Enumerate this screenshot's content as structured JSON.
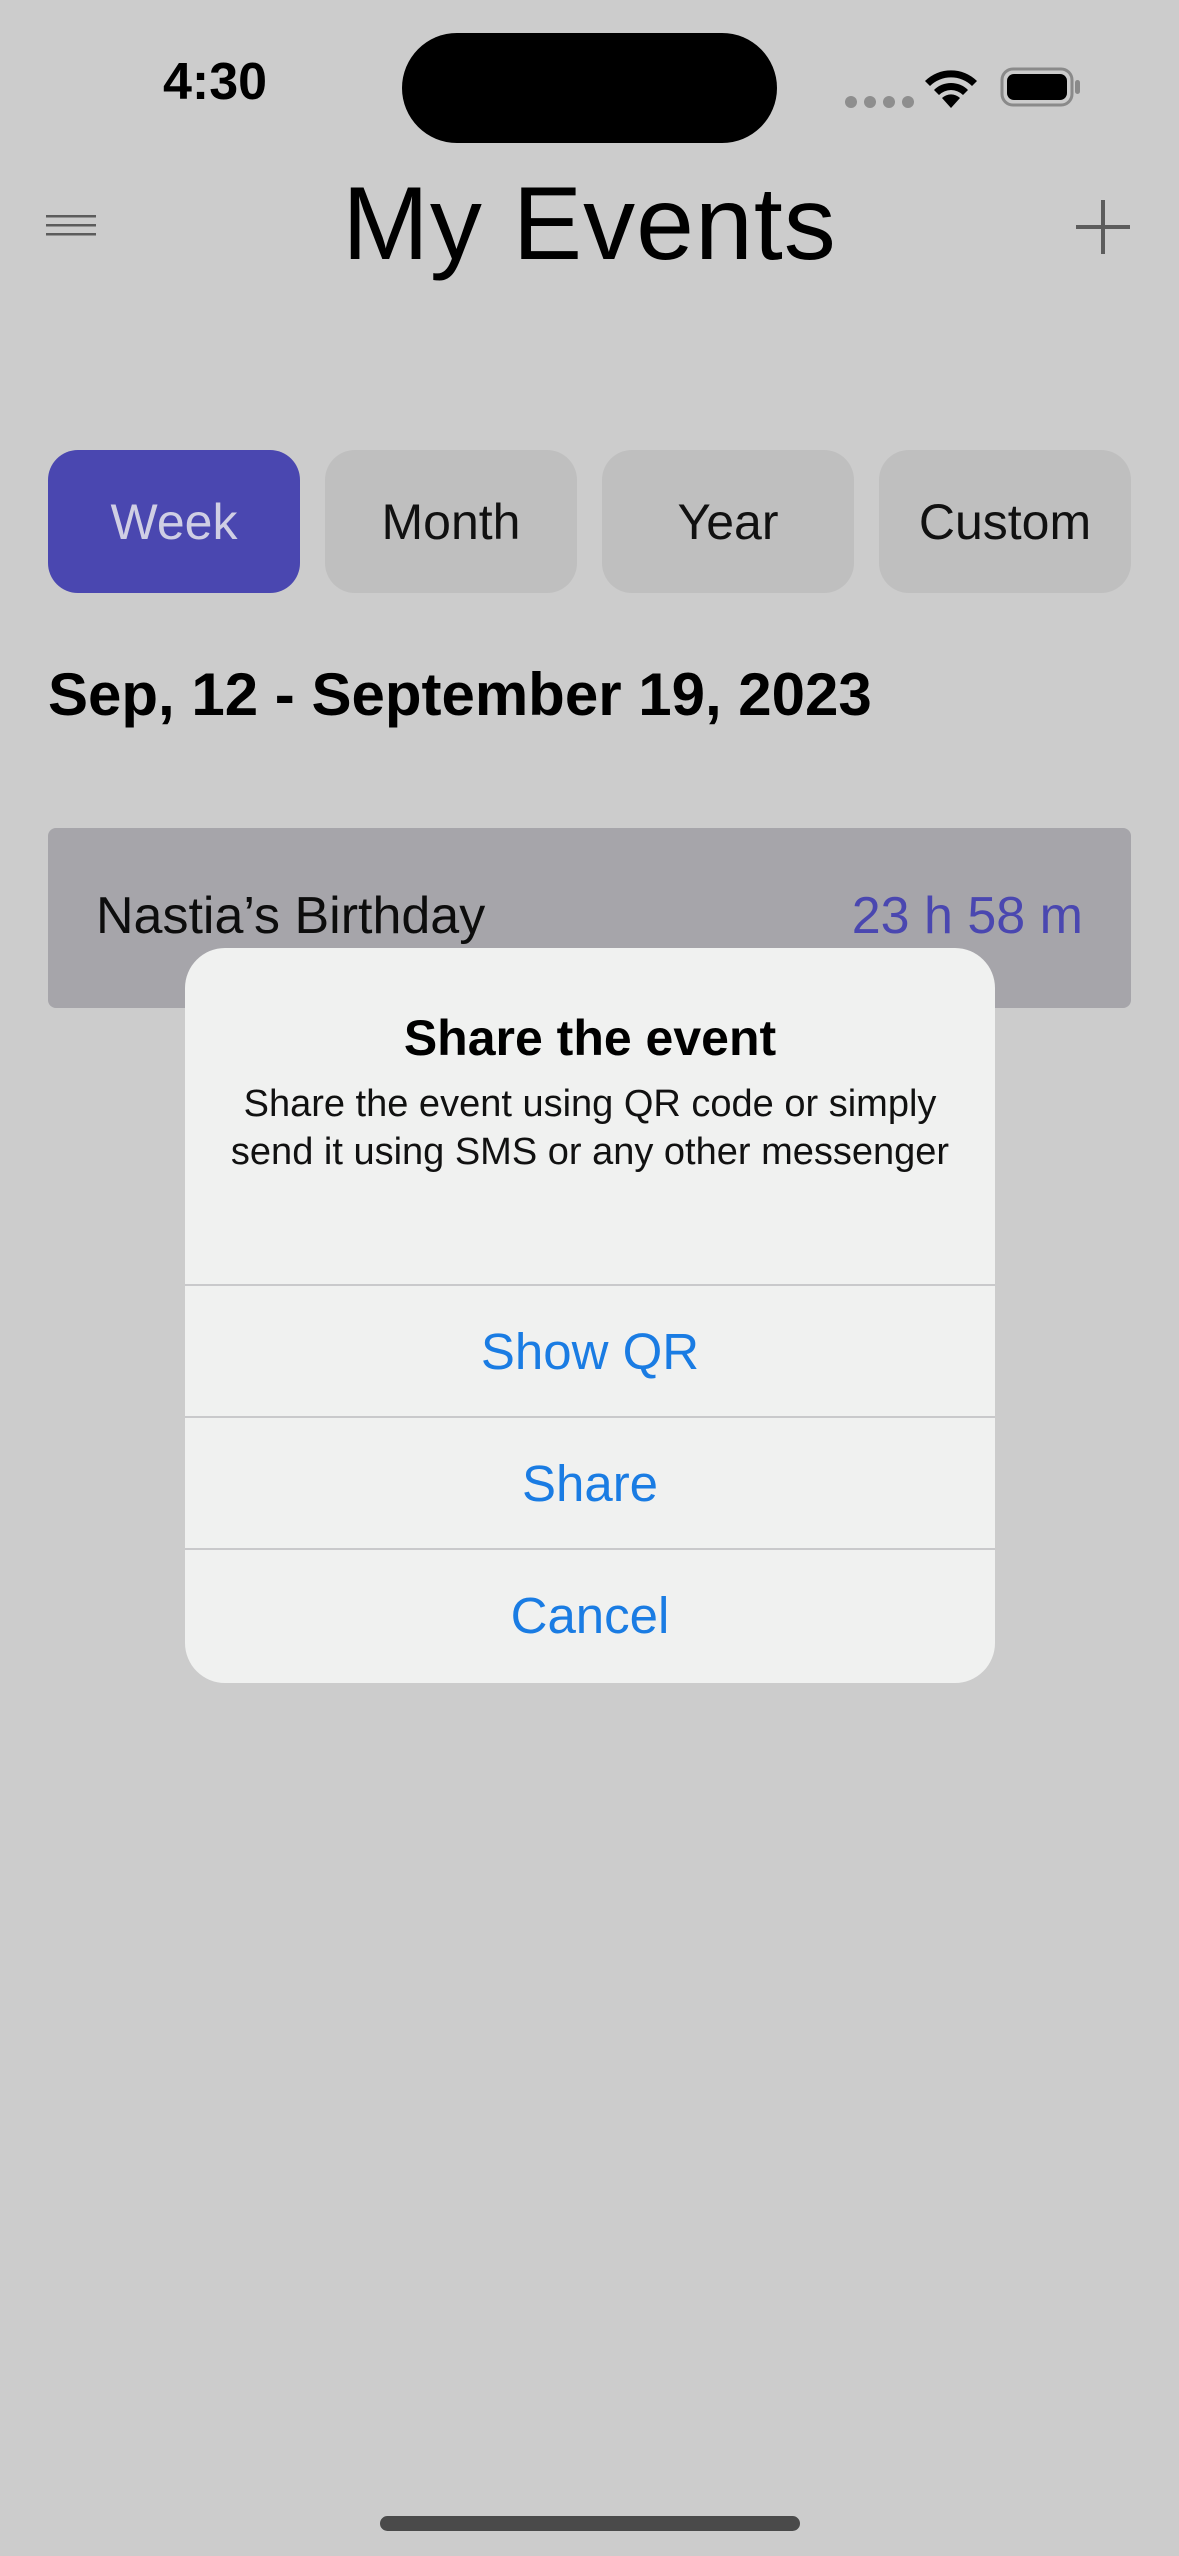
{
  "status_bar": {
    "time": "4:30"
  },
  "header": {
    "title": "My Events",
    "menu_icon": "hamburger-menu-icon",
    "add_icon": "plus-icon"
  },
  "tabs": [
    {
      "label": "Week",
      "active": true
    },
    {
      "label": "Month",
      "active": false
    },
    {
      "label": "Year",
      "active": false
    },
    {
      "label": "Custom",
      "active": false
    }
  ],
  "date_range": "Sep, 12 - September 19, 2023",
  "events": [
    {
      "name": "Nastia’s Birthday",
      "remaining": "23 h 58 m"
    }
  ],
  "alert": {
    "title": "Share the event",
    "message": "Share the event using QR code or simply send it using SMS or any other messenger",
    "actions": [
      {
        "label": "Show QR"
      },
      {
        "label": "Share"
      },
      {
        "label": "Cancel"
      }
    ]
  },
  "colors": {
    "accent": "#4a47b0",
    "action_blue": "#1a7ce3",
    "background_dimmed": "#cccccc"
  }
}
